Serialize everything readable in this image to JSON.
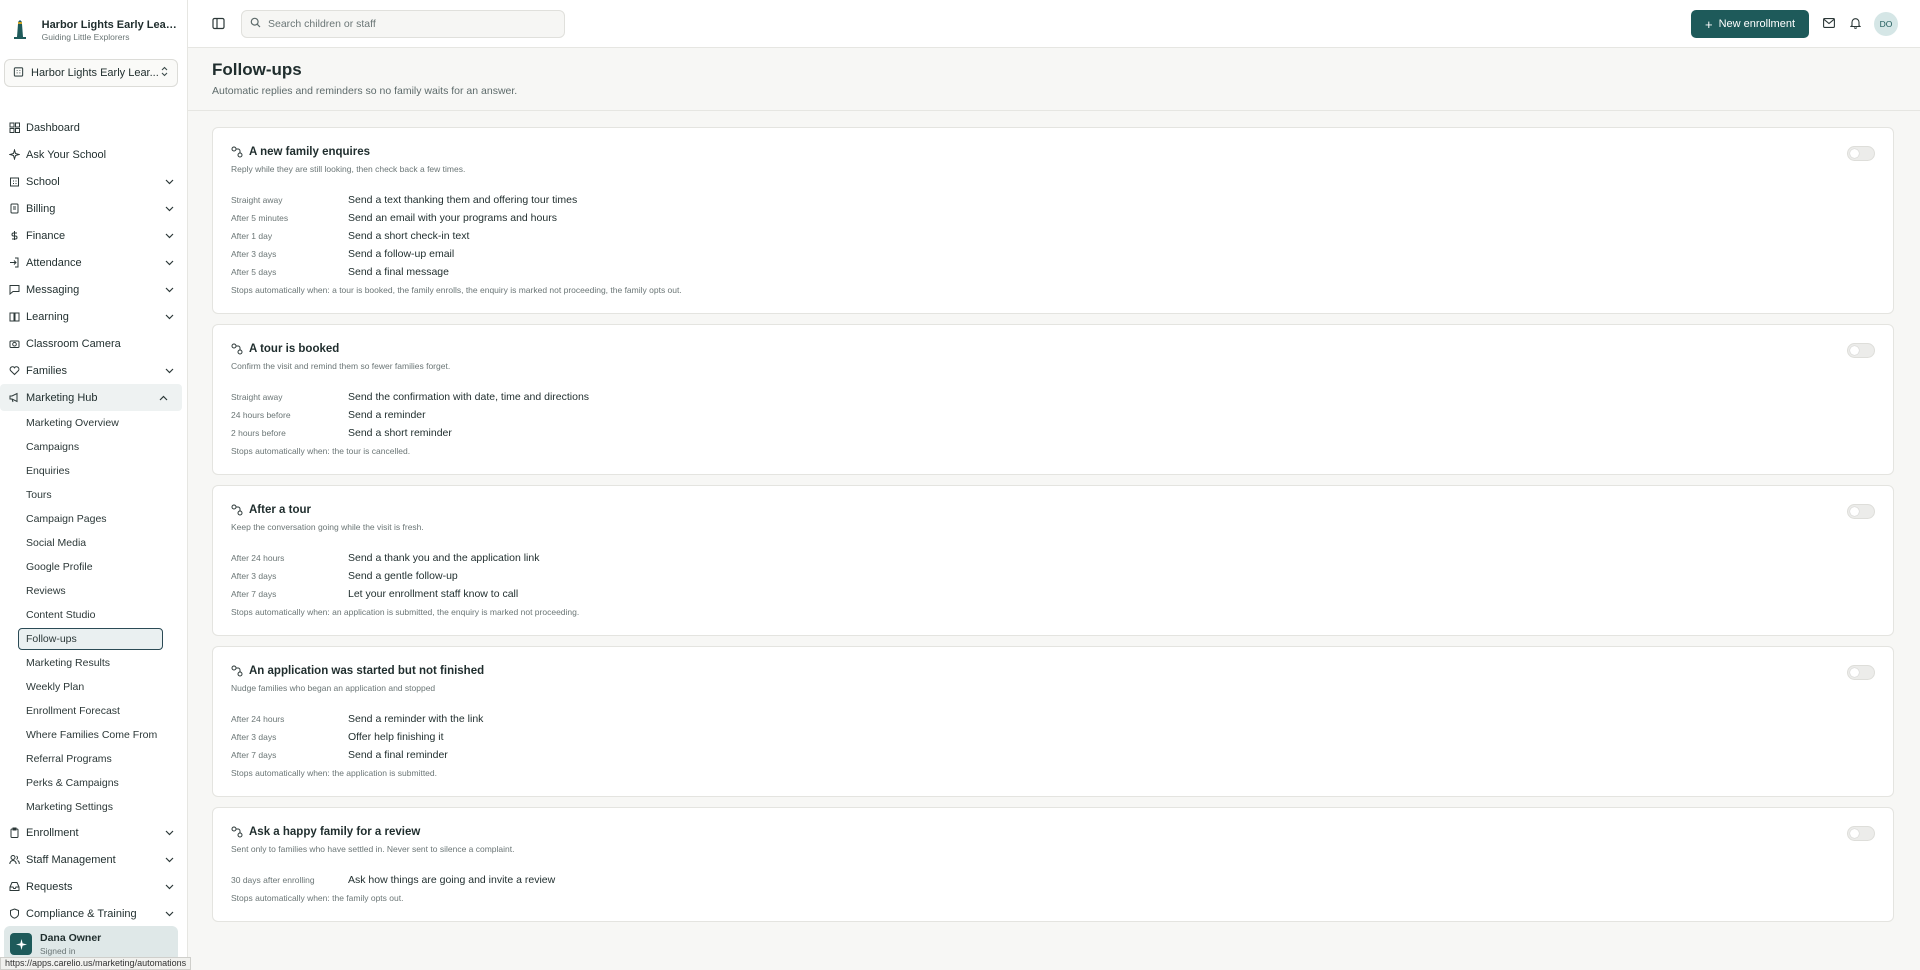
{
  "brand": {
    "name": "Harbor Lights Early Learn...",
    "tagline": "Guiding Little Explorers"
  },
  "school_switcher": {
    "label": "Harbor Lights Early Lear..."
  },
  "sidebar": {
    "items": [
      {
        "label": "Dashboard",
        "icon": "grid-icon",
        "chevron": false
      },
      {
        "label": "Ask Your School",
        "icon": "sparkle-icon",
        "chevron": false
      },
      {
        "label": "School",
        "icon": "building-icon",
        "chevron": true
      },
      {
        "label": "Billing",
        "icon": "receipt-icon",
        "chevron": true
      },
      {
        "label": "Finance",
        "icon": "dollar-icon",
        "chevron": true
      },
      {
        "label": "Attendance",
        "icon": "login-icon",
        "chevron": true
      },
      {
        "label": "Messaging",
        "icon": "message-icon",
        "chevron": true
      },
      {
        "label": "Learning",
        "icon": "book-icon",
        "chevron": true
      },
      {
        "label": "Classroom Camera",
        "icon": "camera-icon",
        "chevron": false
      },
      {
        "label": "Families",
        "icon": "heart-icon",
        "chevron": true
      }
    ],
    "marketing": {
      "label": "Marketing Hub",
      "children": [
        "Marketing Overview",
        "Campaigns",
        "Enquiries",
        "Tours",
        "Campaign Pages",
        "Social Media",
        "Google Profile",
        "Reviews",
        "Content Studio",
        "Follow-ups",
        "Marketing Results",
        "Weekly Plan",
        "Enrollment Forecast",
        "Where Families Come From",
        "Referral Programs",
        "Perks & Campaigns",
        "Marketing Settings"
      ],
      "selected": "Follow-ups"
    },
    "items_after": [
      {
        "label": "Enrollment",
        "icon": "clipboard-icon"
      },
      {
        "label": "Staff Management",
        "icon": "users-icon"
      },
      {
        "label": "Requests",
        "icon": "inbox-icon"
      },
      {
        "label": "Compliance & Training",
        "icon": "shield-icon"
      }
    ]
  },
  "user": {
    "name": "Dana Owner",
    "status": "Signed in"
  },
  "status_url": "https://apps.carelio.us/marketing/automations",
  "topbar": {
    "search_placeholder": "Search children or staff",
    "new_button": "New enrollment",
    "avatar_initials": "DO"
  },
  "page": {
    "title": "Follow-ups",
    "subtitle": "Automatic replies and reminders so no family waits for an answer."
  },
  "cards": [
    {
      "title": "A new family enquires",
      "desc": "Reply while they are still looking, then check back a few times.",
      "enabled": false,
      "steps": [
        {
          "when": "Straight away",
          "what": "Send a text thanking them and offering tour times"
        },
        {
          "when": "After 5 minutes",
          "what": "Send an email with your programs and hours"
        },
        {
          "when": "After 1 day",
          "what": "Send a short check-in text"
        },
        {
          "when": "After 3 days",
          "what": "Send a follow-up email"
        },
        {
          "when": "After 5 days",
          "what": "Send a final message"
        }
      ],
      "stops": "Stops automatically when: a tour is booked, the family enrolls, the enquiry is marked not proceeding, the family opts out."
    },
    {
      "title": "A tour is booked",
      "desc": "Confirm the visit and remind them so fewer families forget.",
      "enabled": false,
      "steps": [
        {
          "when": "Straight away",
          "what": "Send the confirmation with date, time and directions"
        },
        {
          "when": "24 hours before",
          "what": "Send a reminder"
        },
        {
          "when": "2 hours before",
          "what": "Send a short reminder"
        }
      ],
      "stops": "Stops automatically when: the tour is cancelled."
    },
    {
      "title": "After a tour",
      "desc": "Keep the conversation going while the visit is fresh.",
      "enabled": false,
      "steps": [
        {
          "when": "After 24 hours",
          "what": "Send a thank you and the application link"
        },
        {
          "when": "After 3 days",
          "what": "Send a gentle follow-up"
        },
        {
          "when": "After 7 days",
          "what": "Let your enrollment staff know to call"
        }
      ],
      "stops": "Stops automatically when: an application is submitted, the enquiry is marked not proceeding."
    },
    {
      "title": "An application was started but not finished",
      "desc": "Nudge families who began an application and stopped",
      "enabled": false,
      "steps": [
        {
          "when": "After 24 hours",
          "what": "Send a reminder with the link"
        },
        {
          "when": "After 3 days",
          "what": "Offer help finishing it"
        },
        {
          "when": "After 7 days",
          "what": "Send a final reminder"
        }
      ],
      "stops": "Stops automatically when: the application is submitted."
    },
    {
      "title": "Ask a happy family for a review",
      "desc": "Sent only to families who have settled in. Never sent to silence a complaint.",
      "enabled": false,
      "steps": [
        {
          "when": "30 days after enrolling",
          "what": "Ask how things are going and invite a review"
        }
      ],
      "stops": "Stops automatically when: the family opts out."
    }
  ]
}
